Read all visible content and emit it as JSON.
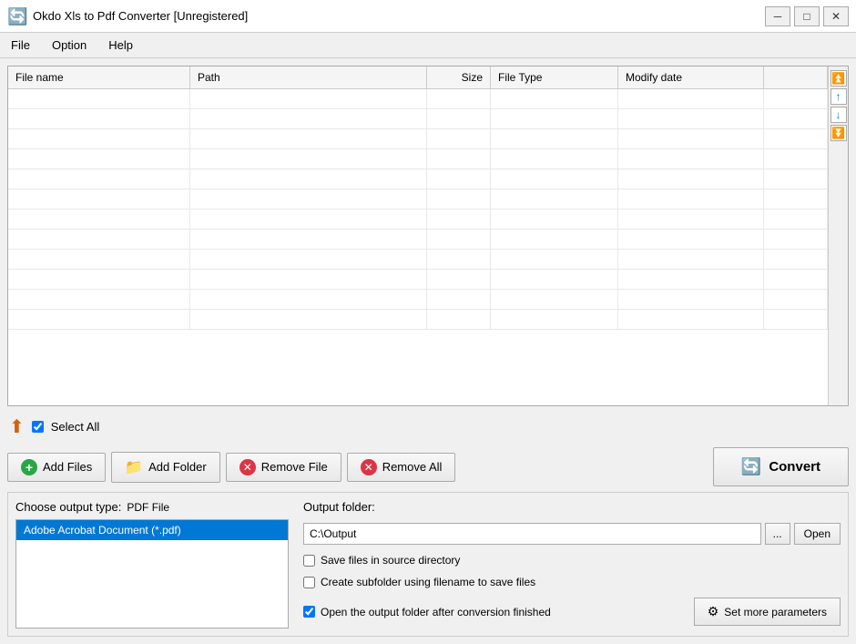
{
  "titleBar": {
    "icon": "🔄",
    "title": "Okdo Xls to Pdf Converter [Unregistered]",
    "minimizeLabel": "─",
    "maximizeLabel": "□",
    "closeLabel": "✕"
  },
  "menuBar": {
    "items": [
      {
        "id": "file",
        "label": "File"
      },
      {
        "id": "option",
        "label": "Option"
      },
      {
        "id": "help",
        "label": "Help"
      }
    ]
  },
  "fileTable": {
    "columns": [
      {
        "id": "filename",
        "label": "File name"
      },
      {
        "id": "path",
        "label": "Path"
      },
      {
        "id": "size",
        "label": "Size"
      },
      {
        "id": "filetype",
        "label": "File Type"
      },
      {
        "id": "modifydate",
        "label": "Modify date"
      }
    ],
    "rows": []
  },
  "scrollControls": {
    "topLabel": "⏫",
    "upLabel": "↑",
    "downLabel": "↓",
    "bottomLabel": "⏬"
  },
  "selectAll": {
    "label": "Select All",
    "checked": true
  },
  "actionButtons": {
    "addFiles": "Add Files",
    "addFolder": "Add Folder",
    "removeFile": "Remove File",
    "removeAll": "Remove All",
    "convert": "Convert"
  },
  "outputType": {
    "label": "Choose output type:",
    "selected": "PDF File",
    "items": [
      {
        "id": "pdf",
        "label": "Adobe Acrobat Document (*.pdf)"
      }
    ]
  },
  "outputFolder": {
    "label": "Output folder:",
    "path": "C:\\Output",
    "browsePlaceholder": "...",
    "openLabel": "Open",
    "checkboxes": [
      {
        "id": "saveInSource",
        "label": "Save files in source directory",
        "checked": false
      },
      {
        "id": "createSubfolder",
        "label": "Create subfolder using filename to save files",
        "checked": false
      },
      {
        "id": "openAfterConversion",
        "label": "Open the output folder after conversion finished",
        "checked": true
      }
    ],
    "setParamsLabel": "Set more parameters"
  }
}
